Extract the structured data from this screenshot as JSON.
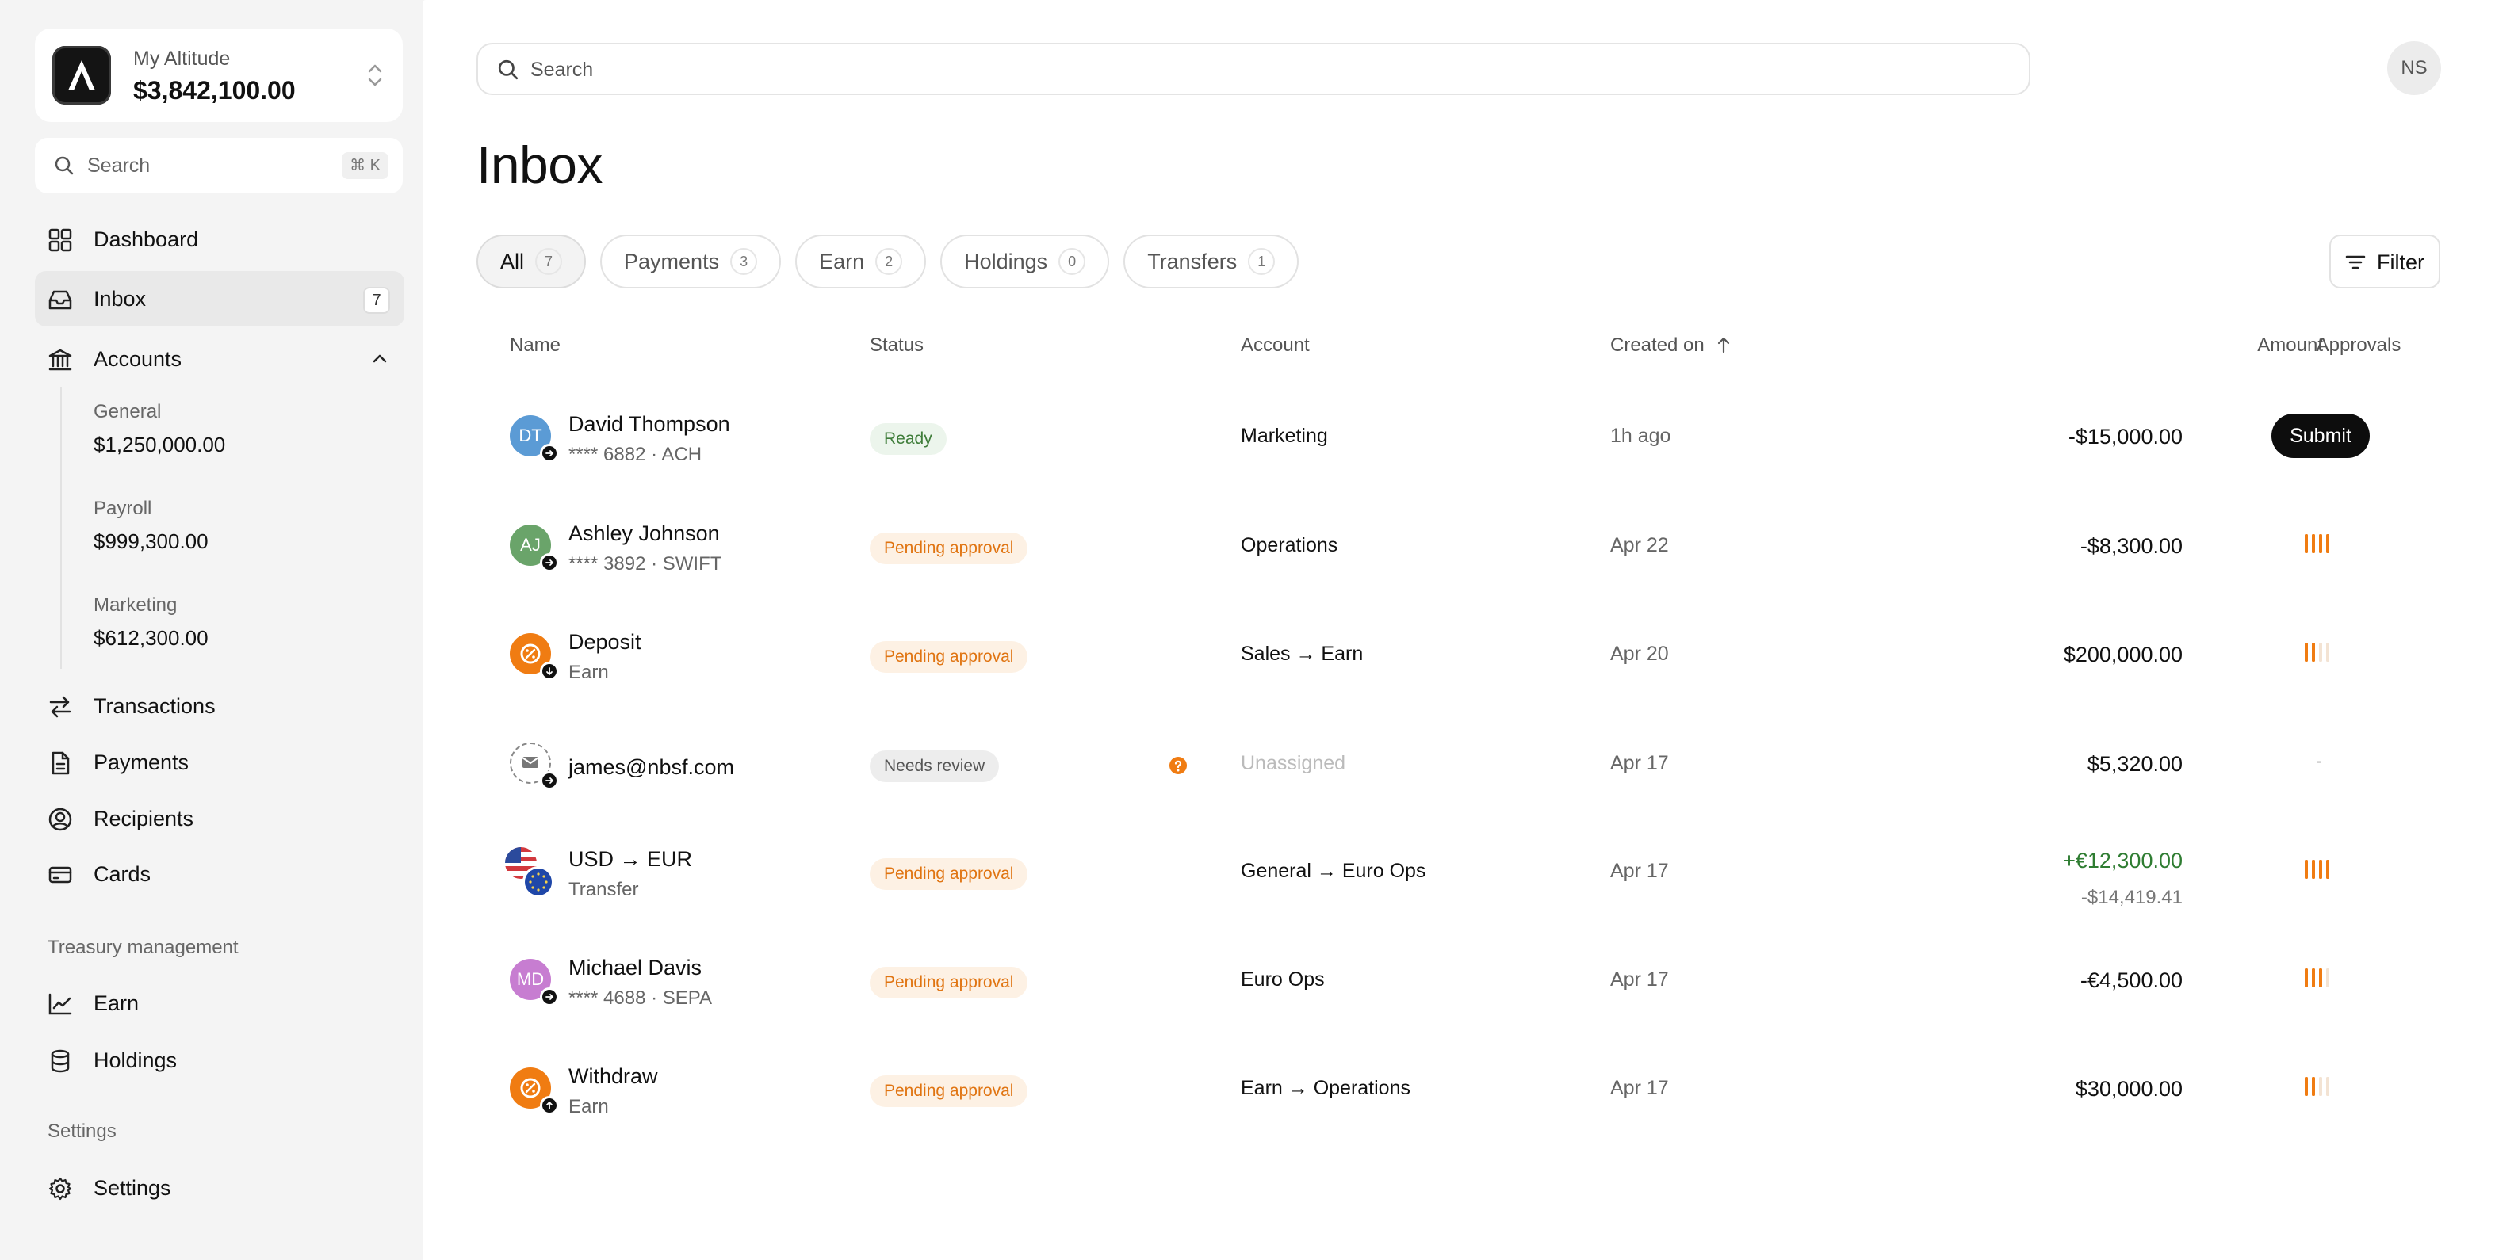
{
  "org": {
    "name": "My Altitude",
    "balance": "$3,842,100.00"
  },
  "sidebar_search": {
    "placeholder": "Search",
    "shortcut": "⌘ K"
  },
  "nav": {
    "dashboard": "Dashboard",
    "inbox": "Inbox",
    "inbox_count": "7",
    "accounts": "Accounts",
    "sub_accounts": [
      {
        "name": "General",
        "balance": "$1,250,000.00"
      },
      {
        "name": "Payroll",
        "balance": "$999,300.00"
      },
      {
        "name": "Marketing",
        "balance": "$612,300.00"
      }
    ],
    "transactions": "Transactions",
    "payments": "Payments",
    "recipients": "Recipients",
    "cards": "Cards",
    "treasury_section": "Treasury management",
    "earn": "Earn",
    "holdings": "Holdings",
    "settings_section": "Settings",
    "settings": "Settings"
  },
  "header": {
    "search_placeholder": "Search",
    "user_initials": "NS"
  },
  "page": {
    "title": "Inbox"
  },
  "tabs": [
    {
      "label": "All",
      "count": "7"
    },
    {
      "label": "Payments",
      "count": "3"
    },
    {
      "label": "Earn",
      "count": "2"
    },
    {
      "label": "Holdings",
      "count": "0"
    },
    {
      "label": "Transfers",
      "count": "1"
    }
  ],
  "filter_label": "Filter",
  "columns": {
    "name": "Name",
    "status": "Status",
    "account": "Account",
    "created": "Created on",
    "amount": "Amount",
    "approvals": "Approvals"
  },
  "rows": [
    {
      "name": "David Thompson",
      "sub": "**** 6882 · ACH",
      "initials": "DT",
      "status": "Ready",
      "account": "Marketing",
      "created": "1h ago",
      "amount": "-$15,000.00",
      "action": "Submit"
    },
    {
      "name": "Ashley Johnson",
      "sub": "**** 3892 · SWIFT",
      "initials": "AJ",
      "status": "Pending approval",
      "account": "Operations",
      "created": "Apr 22",
      "amount": "-$8,300.00",
      "approvals": 4
    },
    {
      "name": "Deposit",
      "sub": "Earn",
      "status": "Pending approval",
      "account": "Sales → Earn",
      "created": "Apr 20",
      "amount": "$200,000.00",
      "approvals": 2
    },
    {
      "name": "james@nbsf.com",
      "status": "Needs review",
      "account": "Unassigned",
      "created": "Apr 17",
      "amount": "$5,320.00",
      "approvals_text": "-"
    },
    {
      "name": "USD → EUR",
      "sub": "Transfer",
      "status": "Pending approval",
      "account": "General → Euro Ops",
      "created": "Apr 17",
      "amount": "+€12,300.00",
      "amount_secondary": "-$14,419.41",
      "approvals": 4
    },
    {
      "name": "Michael Davis",
      "sub": "**** 4688 · SEPA",
      "initials": "MD",
      "status": "Pending approval",
      "account": "Euro Ops",
      "created": "Apr 17",
      "amount": "-€4,500.00",
      "approvals": 3
    },
    {
      "name": "Withdraw",
      "sub": "Earn",
      "status": "Pending approval",
      "account": "Earn → Operations",
      "created": "Apr 17",
      "amount": "$30,000.00",
      "approvals": 2
    }
  ],
  "colors": {
    "accent_orange": "#f07c12",
    "ready_green": "#3f7d3a",
    "positive_green": "#2f7d32",
    "avatar_dt": "#5b9bd5",
    "avatar_aj": "#6aa46a",
    "avatar_md": "#c77dd1"
  }
}
